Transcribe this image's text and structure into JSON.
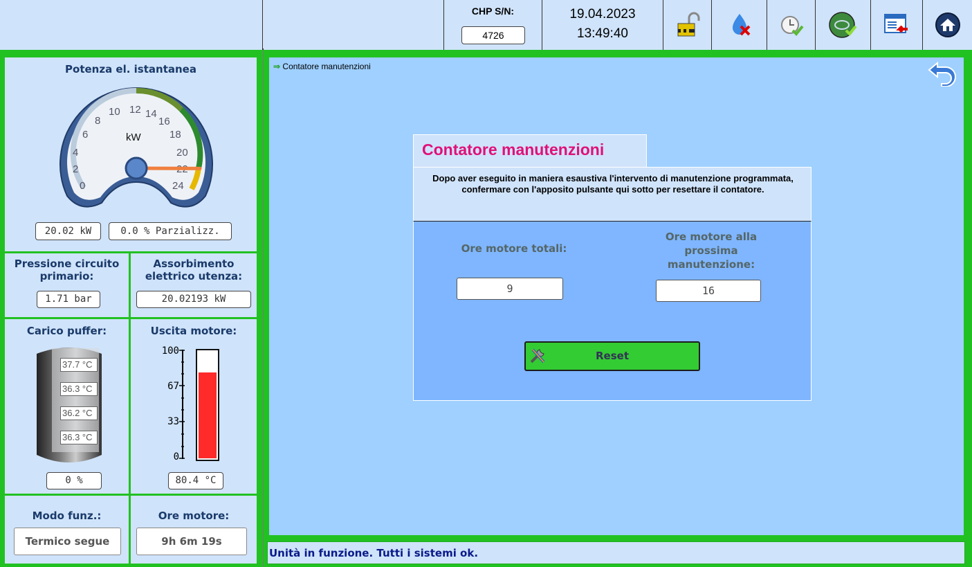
{
  "header": {
    "sn_label": "CHP S/N:",
    "sn_value": "4726",
    "date": "19.04.2023",
    "time": "13:49:40"
  },
  "gauge": {
    "title": "Potenza el. istantanea",
    "unit": "kW",
    "ticks": [
      "0",
      "2",
      "4",
      "6",
      "8",
      "10",
      "12",
      "14",
      "16",
      "18",
      "20",
      "22",
      "24"
    ],
    "value": 20.02,
    "power_text": "20.02 kW",
    "part_text": "0.0 % Parzializz."
  },
  "pressure": {
    "label": "Pressione circuito primario:",
    "value": "1.71 bar"
  },
  "absorption": {
    "label": "Assorbimento elettrico utenza:",
    "value": "20.02193 kW"
  },
  "buffer": {
    "label": "Carico puffer:",
    "temps": [
      "37.7 °C",
      "36.3 °C",
      "36.2 °C",
      "36.3 °C"
    ],
    "percent": "0 %"
  },
  "engine_out": {
    "label": "Uscita motore:",
    "scale": [
      "100",
      "67",
      "33",
      "0"
    ],
    "level": 0.804,
    "value": "80.4 °C"
  },
  "mode": {
    "label": "Modo funz.:",
    "value": "Termico segue"
  },
  "hours": {
    "label": "Ore motore:",
    "value": "9h 6m 19s"
  },
  "main": {
    "breadcrumb": "Contatore manutenzioni",
    "dialog_title": "Contatore manutenzioni",
    "dialog_text": "Dopo aver eseguito in maniera esaustiva l'intervento di manutenzione programmata, confermare con l'apposito pulsante qui sotto per resettare il contatore.",
    "total_label": "Ore motore totali:",
    "total_value": "9",
    "next_label": "Ore motore alla prossima manutenzione:",
    "next_value": "16",
    "reset_label": "Reset"
  },
  "status": "Unità in funzione. Tutti i sistemi ok.",
  "icons": [
    "unlock-icon",
    "burner-fault-icon",
    "timer-ok-icon",
    "engine-ok-icon",
    "window-back-icon",
    "home-icon",
    "back-arrow-icon",
    "tools-icon"
  ],
  "colors": {
    "title_pink": "#e0107a",
    "green": "#22c122",
    "bar_red": "#ff2a2a",
    "status_text": "#0a1a8a"
  }
}
